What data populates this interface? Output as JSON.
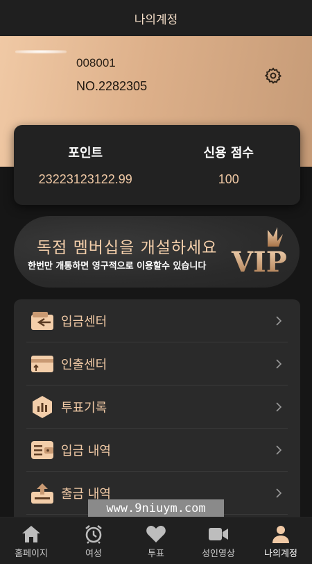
{
  "header": {
    "title": "나의계정"
  },
  "profile": {
    "user_id": "008001",
    "user_no": "NO.2282305"
  },
  "points": [
    {
      "label": "포인트",
      "value": "23223123122.99"
    },
    {
      "label": "신용 점수",
      "value": "100"
    }
  ],
  "vip_banner": {
    "title": "독점 멤버십을 개설하세요",
    "subtitle": "한번만 개통하면 영구적으로 이용할수 있습니다",
    "badge_text": "VIP"
  },
  "menu": [
    {
      "label": "입금센터",
      "icon": "wallet-icon"
    },
    {
      "label": "인출센터",
      "icon": "card-withdraw-icon"
    },
    {
      "label": "투표기록",
      "icon": "bar-chart-icon"
    },
    {
      "label": "입금 내역",
      "icon": "deposit-history-icon"
    },
    {
      "label": "출금 내역",
      "icon": "withdraw-history-icon"
    }
  ],
  "watermark": "www.9niuym.com",
  "tabbar": [
    {
      "label": "홈페이지",
      "icon": "home-icon",
      "active": false
    },
    {
      "label": "여성",
      "icon": "alarm-clock-icon",
      "active": false
    },
    {
      "label": "투표",
      "icon": "heart-icon",
      "active": false
    },
    {
      "label": "성인영상",
      "icon": "video-camera-icon",
      "active": false
    },
    {
      "label": "나의계정",
      "icon": "user-icon",
      "active": true
    }
  ],
  "colors": {
    "accent": "#f0c9a5",
    "background": "#161616",
    "card": "#222222"
  }
}
